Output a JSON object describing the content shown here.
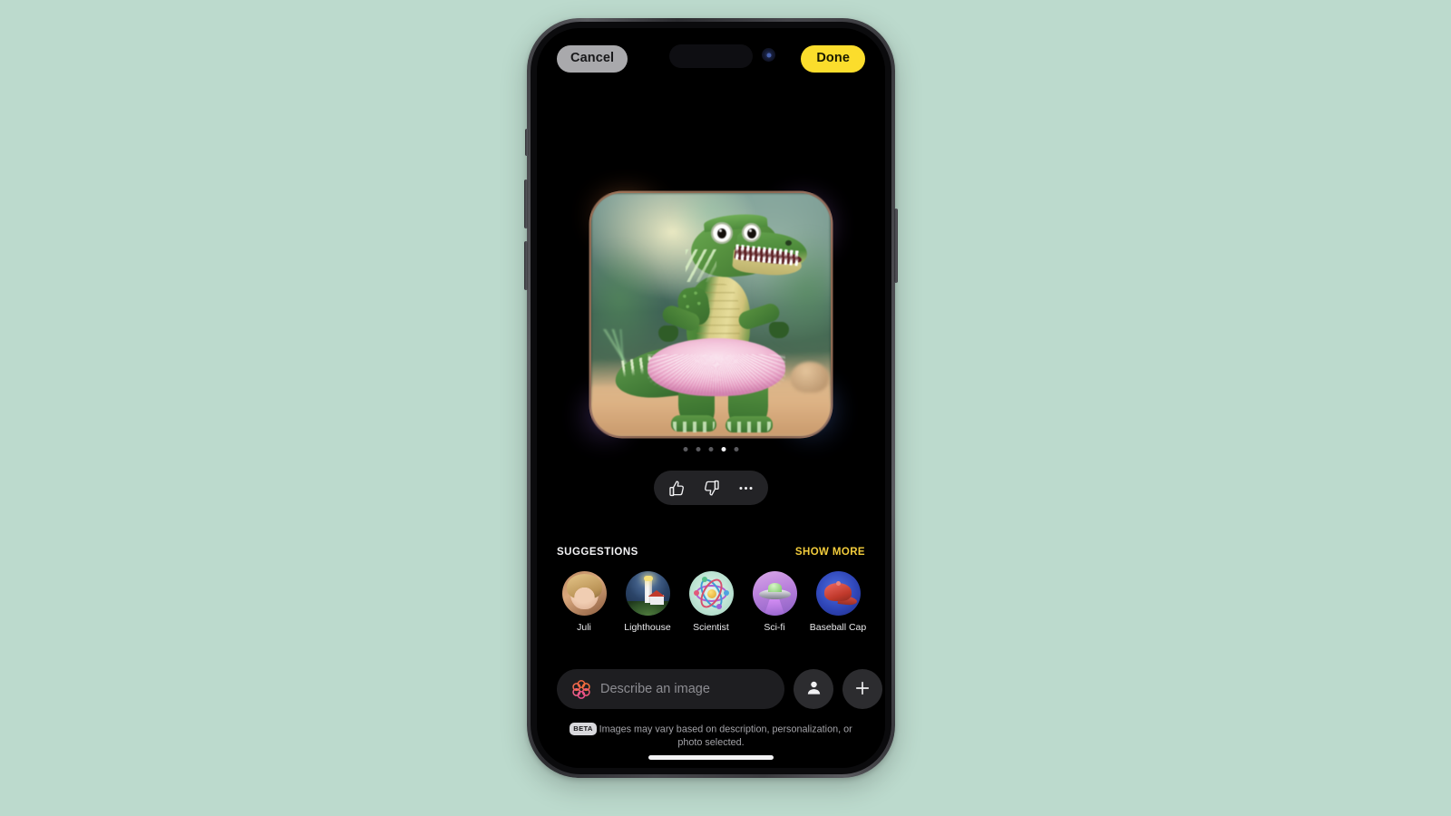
{
  "background_color": "#bcdacd",
  "device": {
    "name": "iphone-frame",
    "body_color": "#3d3d41",
    "screen_color": "#000000"
  },
  "topbar": {
    "cancel_label": "Cancel",
    "done_label": "Done",
    "cancel_bg": "#a9a9ac",
    "done_bg": "#fbdd2c"
  },
  "canvas": {
    "image_description": "3D cartoon alligator standing upright wearing a pink ruffled tutu, in a blurred green swamp setting",
    "glow_colors": [
      "#f08a4a",
      "#a96fe0",
      "#8e63d8",
      "#4f74d6"
    ],
    "page_dots": {
      "count": 5,
      "active_index": 3
    },
    "feedback": {
      "thumbs_up": "thumbs-up-icon",
      "thumbs_down": "thumbs-down-icon",
      "more": "more-options-icon"
    }
  },
  "suggestions": {
    "title": "SUGGESTIONS",
    "show_more_label": "SHOW MORE",
    "show_more_color": "#f2cc3c",
    "items": [
      {
        "label": "Juli",
        "thumb": "portrait-photo-thumbnail"
      },
      {
        "label": "Lighthouse",
        "thumb": "lighthouse-thumbnail"
      },
      {
        "label": "Scientist",
        "thumb": "atom-thumbnail"
      },
      {
        "label": "Sci-fi",
        "thumb": "ufo-thumbnail"
      },
      {
        "label": "Baseball Cap",
        "thumb": "red-cap-thumbnail"
      }
    ]
  },
  "prompt": {
    "placeholder": "Describe an image",
    "value": "",
    "leading_icon": "apple-intelligence-icon",
    "person_button": "person-icon",
    "add_button": "plus-icon"
  },
  "footer": {
    "beta_badge": "BETA",
    "note": "Images may vary based on description, personalization, or photo selected."
  }
}
